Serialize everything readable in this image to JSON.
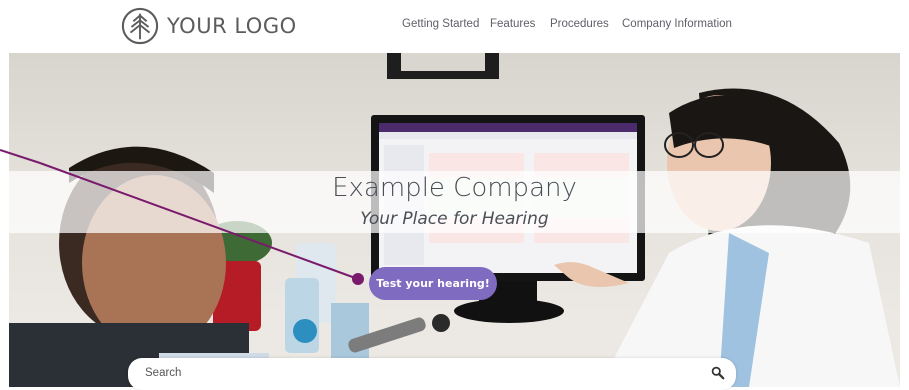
{
  "header": {
    "logo_text": "YOUR LOGO",
    "logo_icon": "tree-icon",
    "nav": [
      {
        "label": "Getting Started"
      },
      {
        "label": "Features"
      },
      {
        "label": "Procedures"
      },
      {
        "label": "Company Information"
      }
    ]
  },
  "hero": {
    "title": "Example Company",
    "tagline": "Your Place for Hearing",
    "cta_label": "Test your hearing!"
  },
  "search": {
    "placeholder": "Search",
    "value": ""
  },
  "colors": {
    "accent": "#7f6bc0",
    "pointer": "#7a1a6c",
    "text": "#5f6168"
  }
}
